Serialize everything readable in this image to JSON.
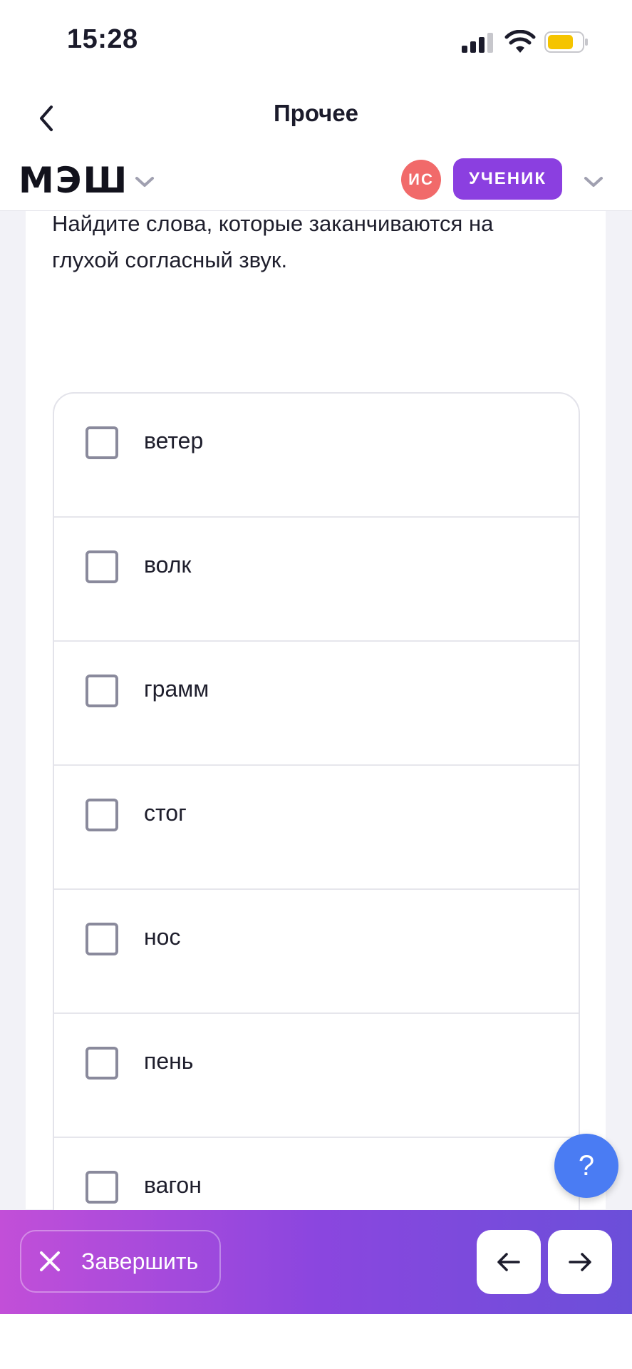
{
  "status_bar": {
    "time": "15:28"
  },
  "nav": {
    "title": "Прочее"
  },
  "header": {
    "logo": "МЭШ",
    "avatar_initials": "ИС",
    "role": "УЧЕНИК"
  },
  "task": {
    "question": "Найдите слова, которые заканчиваются на глухой согласный звук.",
    "options": [
      {
        "label": "ветер",
        "checked": false
      },
      {
        "label": "волк",
        "checked": false
      },
      {
        "label": "грамм",
        "checked": false
      },
      {
        "label": "стог",
        "checked": false
      },
      {
        "label": "нос",
        "checked": false
      },
      {
        "label": "пень",
        "checked": false
      },
      {
        "label": "вагон",
        "checked": false
      }
    ]
  },
  "help_button": {
    "label": "?"
  },
  "bottom_bar": {
    "finish_label": "Завершить"
  },
  "colors": {
    "accent_purple": "#8b3fe0",
    "avatar_red": "#f16a6a",
    "help_blue": "#4a7cf3",
    "battery_yellow": "#f5c400"
  }
}
